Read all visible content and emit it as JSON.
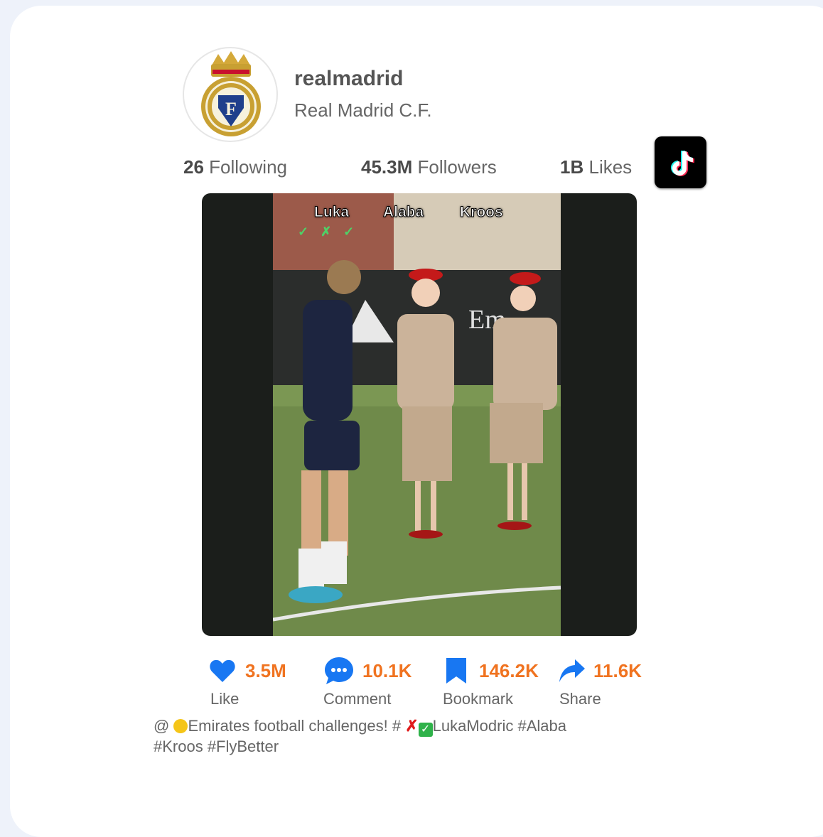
{
  "profile": {
    "username": "realmadrid",
    "display_name": "Real Madrid C.F.",
    "avatar_icon": "real-madrid-crest"
  },
  "stats": {
    "following_count": "26",
    "following_label": "Following",
    "followers_count": "45.3M",
    "followers_label": "Followers",
    "likes_count": "1B",
    "likes_label": "Likes"
  },
  "platform_icon": "tiktok-logo",
  "video": {
    "overlay_names": [
      "Luka",
      "Alaba",
      "Kroos"
    ],
    "overlay_marks": "✓ ✗ ✓"
  },
  "actions": [
    {
      "icon": "heart-icon",
      "count": "3.5M",
      "label": "Like"
    },
    {
      "icon": "comment-icon",
      "count": "10.1K",
      "label": "Comment"
    },
    {
      "icon": "bookmark-icon",
      "count": "146.2K",
      "label": "Bookmark"
    },
    {
      "icon": "share-icon",
      "count": "11.6K",
      "label": "Share"
    }
  ],
  "caption": {
    "prefix": "@ ",
    "text_1": "Emirates football challenges! # ",
    "text_2": "LukaModric #Alaba",
    "text_3": "#Kroos #FlyBetter"
  },
  "colors": {
    "accent_count": "#f07320",
    "icon_blue": "#1877f2",
    "background": "#eef2fa"
  }
}
